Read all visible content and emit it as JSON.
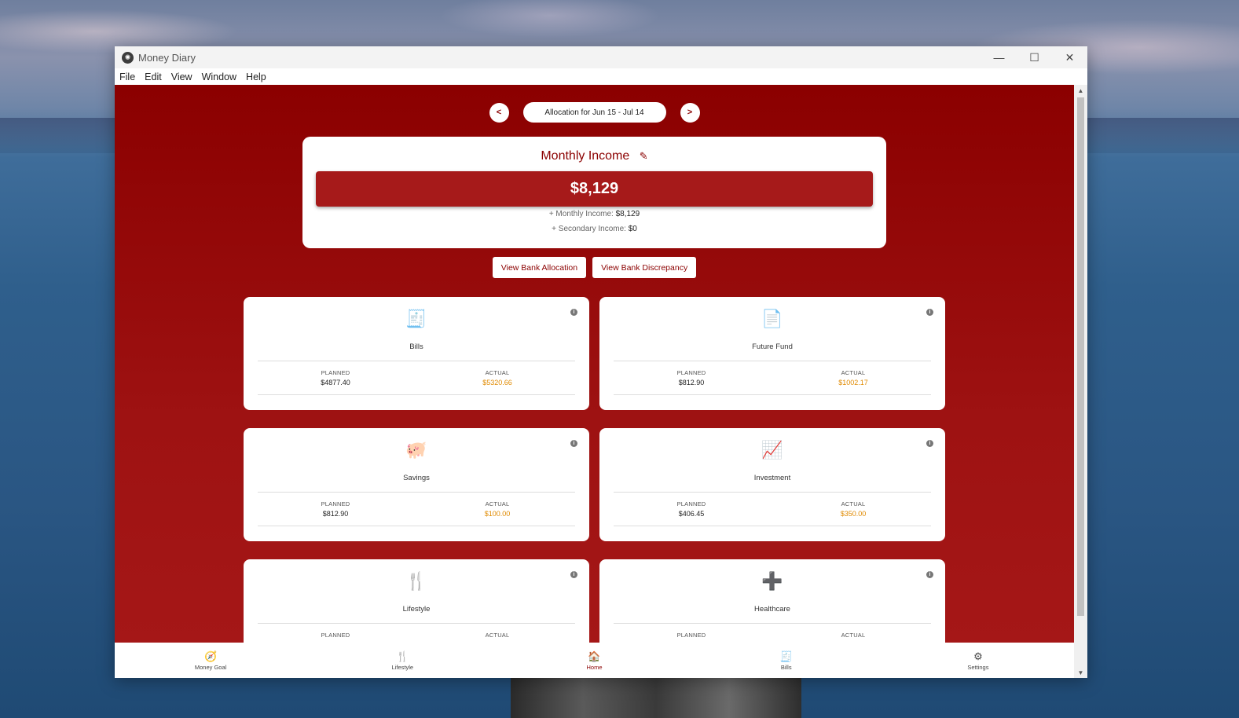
{
  "window": {
    "title": "Money Diary",
    "controls": {
      "minimize": "—",
      "maximize": "☐",
      "close": "✕"
    }
  },
  "menu": [
    "File",
    "Edit",
    "View",
    "Window",
    "Help"
  ],
  "period": {
    "prev": "<",
    "label": "Allocation for Jun 15 - Jul 14",
    "next": ">"
  },
  "income": {
    "title": "Monthly Income",
    "total": "$8,129",
    "monthly_prefix": "+ Monthly Income:",
    "monthly_value": "$8,129",
    "secondary_prefix": "+ Secondary Income:",
    "secondary_value": "$0"
  },
  "buttons": {
    "bank_allocation": "View Bank Allocation",
    "bank_discrepancy": "View Bank Discrepancy"
  },
  "categories": [
    {
      "name": "Bills",
      "icon": "receipt-icon",
      "glyph": "🧾",
      "planned_label": "PLANNED",
      "planned": "$4877.40",
      "actual_label": "ACTUAL",
      "actual": "$5320.66"
    },
    {
      "name": "Future Fund",
      "icon": "document-dollar-icon",
      "glyph": "📄",
      "planned_label": "PLANNED",
      "planned": "$812.90",
      "actual_label": "ACTUAL",
      "actual": "$1002.17"
    },
    {
      "name": "Savings",
      "icon": "piggy-bank-icon",
      "glyph": "🐖",
      "planned_label": "PLANNED",
      "planned": "$812.90",
      "actual_label": "ACTUAL",
      "actual": "$100.00"
    },
    {
      "name": "Investment",
      "icon": "chart-line-icon",
      "glyph": "📈",
      "planned_label": "PLANNED",
      "planned": "$406.45",
      "actual_label": "ACTUAL",
      "actual": "$350.00"
    },
    {
      "name": "Lifestyle",
      "icon": "utensils-icon",
      "glyph": "🍴",
      "planned_label": "PLANNED",
      "planned": "",
      "actual_label": "ACTUAL",
      "actual": ""
    },
    {
      "name": "Healthcare",
      "icon": "medical-plus-icon",
      "glyph": "➕",
      "planned_label": "PLANNED",
      "planned": "",
      "actual_label": "ACTUAL",
      "actual": ""
    }
  ],
  "bottom_nav": [
    {
      "label": "Money Goal",
      "icon": "compass-icon",
      "glyph": "🧭",
      "active": false
    },
    {
      "label": "Lifestyle",
      "icon": "utensils-icon",
      "glyph": "🍴",
      "active": false
    },
    {
      "label": "Home",
      "icon": "home-icon",
      "glyph": "🏠",
      "active": true
    },
    {
      "label": "Bills",
      "icon": "receipt-icon",
      "glyph": "🧾",
      "active": false
    },
    {
      "label": "Settings",
      "icon": "gear-icon",
      "glyph": "⚙",
      "active": false
    }
  ],
  "colors": {
    "accent": "#8b0000",
    "income_bar": "#a61a1a",
    "actual": "#e08a00"
  }
}
